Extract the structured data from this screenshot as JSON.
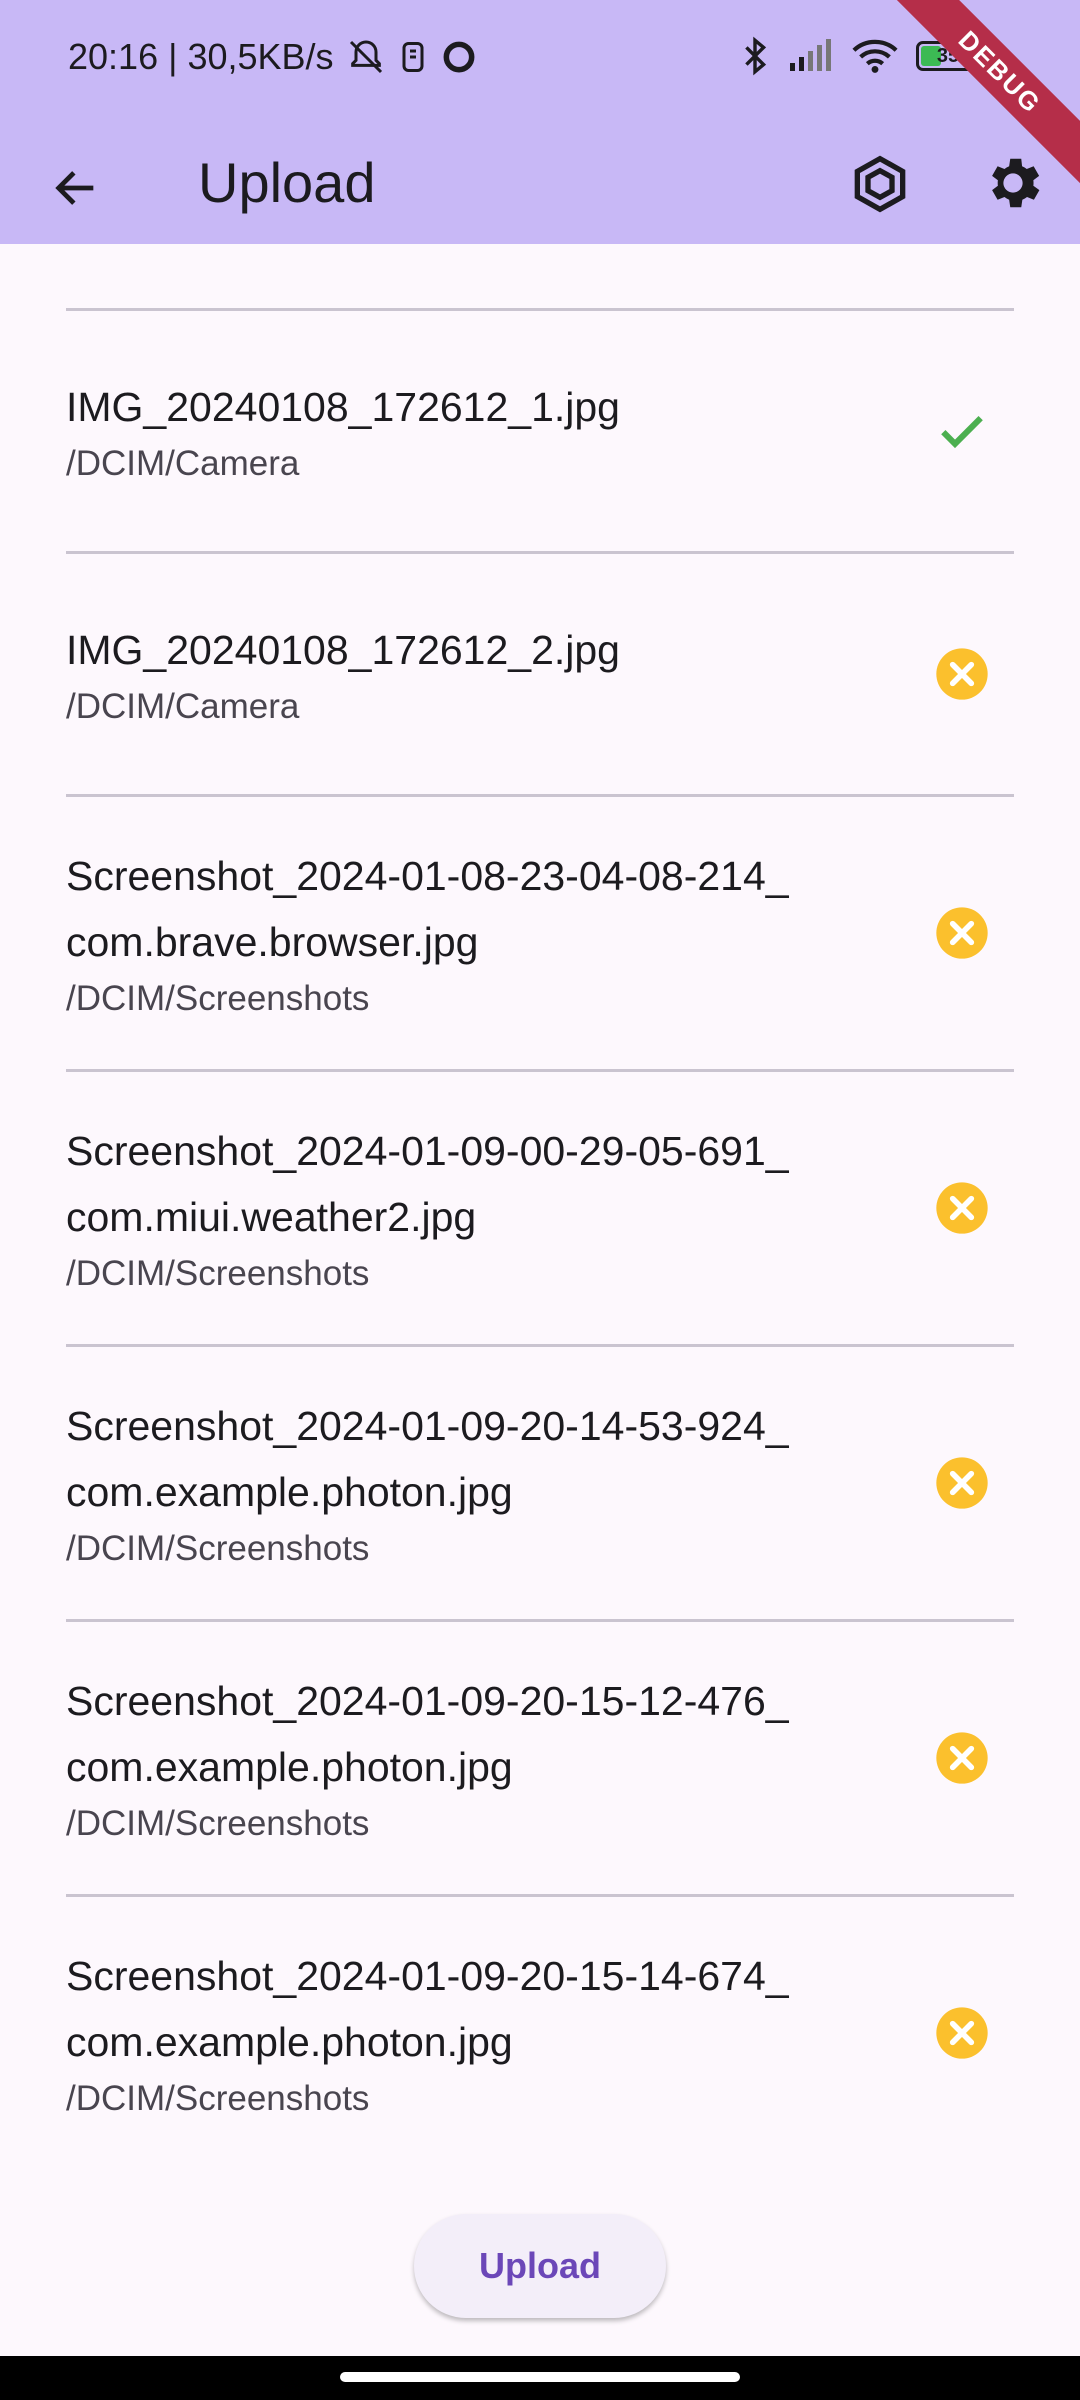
{
  "status_bar": {
    "time_speed": "20:16 | 30,5KB/s",
    "battery": "35"
  },
  "debug_banner": "DEBUG",
  "app_bar": {
    "title": "Upload",
    "icons": [
      "arrow-back-icon",
      "cube-icon",
      "settings-icon"
    ]
  },
  "files": [
    {
      "name": "IMG_20240108_172612_1.jpg",
      "path": "/DCIM/Camera",
      "status": "uploaded"
    },
    {
      "name": "IMG_20240108_172612_2.jpg",
      "path": "/DCIM/Camera",
      "status": "failed"
    },
    {
      "name": "Screenshot_2024-01-08-23-04-08-214_ com.brave.browser.jpg",
      "path": "/DCIM/Screenshots",
      "status": "failed"
    },
    {
      "name": "Screenshot_2024-01-09-00-29-05-691_ com.miui.weather2.jpg",
      "path": "/DCIM/Screenshots",
      "status": "failed"
    },
    {
      "name": "Screenshot_2024-01-09-20-14-53-924_ com.example.photon.jpg",
      "path": "/DCIM/Screenshots",
      "status": "failed"
    },
    {
      "name": "Screenshot_2024-01-09-20-15-12-476_ com.example.photon.jpg",
      "path": "/DCIM/Screenshots",
      "status": "failed"
    },
    {
      "name": "Screenshot_2024-01-09-20-15-14-674_ com.example.photon.jpg",
      "path": "/DCIM/Screenshots",
      "status": "failed"
    }
  ],
  "upload_button": "Upload",
  "colors": {
    "app_bar": "#c8b8f6",
    "success": "#4caf50",
    "failed": "#fbc02d",
    "button_text": "#6b47b8"
  }
}
